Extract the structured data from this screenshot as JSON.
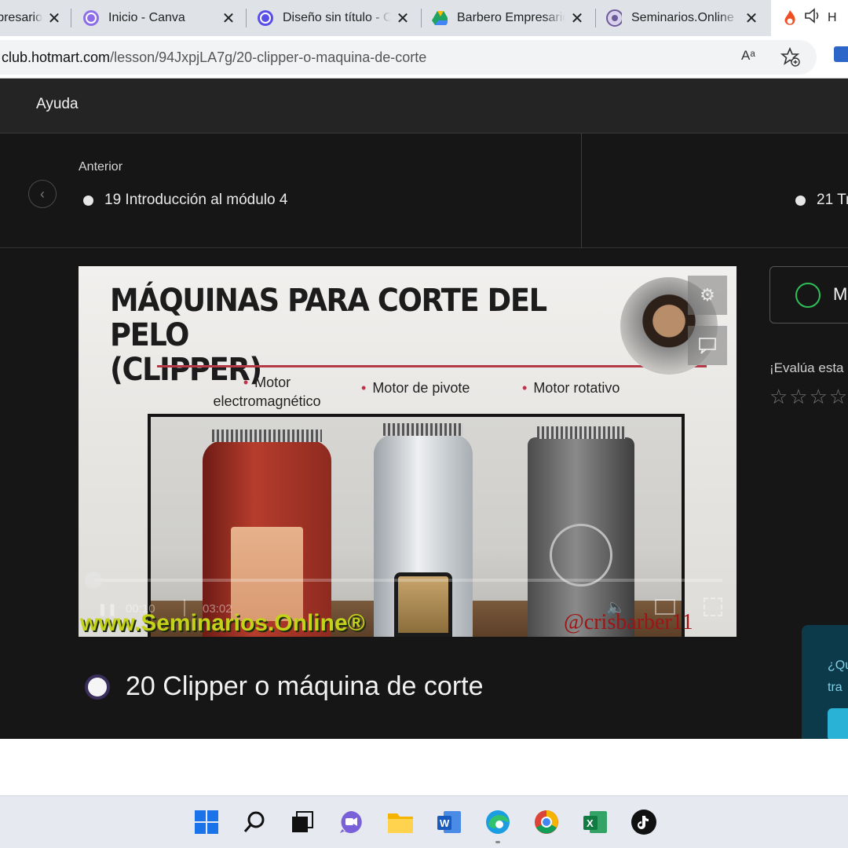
{
  "browser": {
    "tabs": [
      {
        "title": "Empresario",
        "icon": "hotmart-icon"
      },
      {
        "title": "Inicio - Canva",
        "icon": "canva-icon"
      },
      {
        "title": "Diseño sin título - Canva",
        "icon": "canva-icon"
      },
      {
        "title": "Barbero Empresario",
        "icon": "google-drive-icon"
      },
      {
        "title": "Seminarios.Online",
        "icon": "hotmart-icon"
      },
      {
        "title": "H",
        "icon": "hotmart-flame-icon"
      }
    ],
    "url_host": "club.hotmart.com",
    "url_path": "/lesson/94JxpjLA7g/20-clipper-o-maquina-de-corte",
    "read_aloud": "Aᵃ"
  },
  "topbar": {
    "help": "Ayuda"
  },
  "nav": {
    "prev_caption": "Anterior",
    "prev_lesson": "19 Introducción al módulo 4",
    "next_lesson": "21 Tr"
  },
  "video": {
    "slide_title_1": "MÁQUINAS PARA CORTE DEL PELO",
    "slide_title_2": "(CLIPPER)",
    "bullets": [
      "Motor electromagnético",
      "Motor de pivote",
      "Motor rotativo"
    ],
    "time_current": "00:10",
    "time_total": "03:02",
    "watermark": "www.Seminarios.Online®",
    "watermark_handle": "@crisbarber11"
  },
  "lesson": {
    "title": "20 Clipper o máquina de corte"
  },
  "sidebar": {
    "complete_label": "M",
    "rate_label": "¡Evalúa esta",
    "stars": "☆☆☆☆",
    "help_q1": "¿Qu",
    "help_q2": "tra"
  },
  "taskbar": {
    "apps": [
      "windows-start-icon",
      "search-icon",
      "task-view-icon",
      "teams-chat-icon",
      "file-explorer-icon",
      "word-icon",
      "edge-icon",
      "chrome-icon",
      "excel-icon",
      "tiktok-icon"
    ]
  },
  "colors": {
    "page_bg": "#161616",
    "topbar_bg": "#242424",
    "accent_green": "#2fbf57",
    "watermark_yellow": "#c5d21a",
    "slide_red": "#b43a47"
  }
}
